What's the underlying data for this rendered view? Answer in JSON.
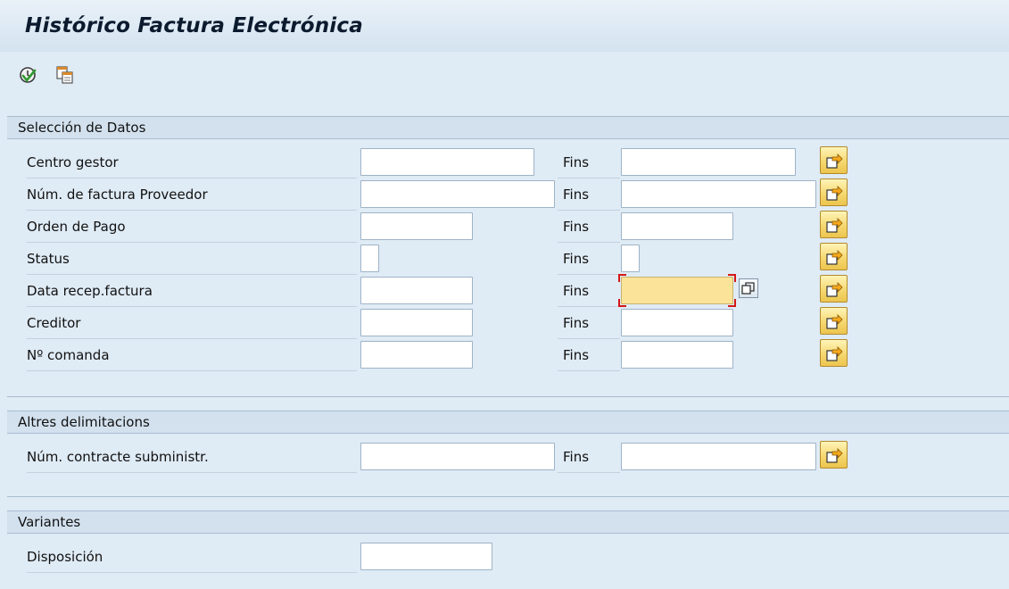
{
  "window": {
    "title": "Histórico Factura Electrónica"
  },
  "toolbar": {
    "items": [
      {
        "icon": "execute-icon"
      },
      {
        "icon": "get-variant-icon"
      }
    ]
  },
  "sections": {
    "data_selection": {
      "header": "Selección de Datos",
      "rows": [
        {
          "label": "Centro gestor",
          "to_label": "Fins",
          "from_value": "",
          "to_value": ""
        },
        {
          "label": "Núm. de factura Proveedor",
          "to_label": "Fins",
          "from_value": "",
          "to_value": ""
        },
        {
          "label": "Orden de Pago",
          "to_label": "Fins",
          "from_value": "",
          "to_value": ""
        },
        {
          "label": "Status",
          "to_label": "Fins",
          "from_value": "",
          "to_value": ""
        },
        {
          "label": "Data recep.factura",
          "to_label": "Fins",
          "from_value": "",
          "to_value": ""
        },
        {
          "label": "Creditor",
          "to_label": "Fins",
          "from_value": "",
          "to_value": ""
        },
        {
          "label": "Nº comanda",
          "to_label": "Fins",
          "from_value": "",
          "to_value": ""
        }
      ]
    },
    "other_limits": {
      "header": "Altres delimitacions",
      "rows": [
        {
          "label": "Núm. contracte subministr.",
          "to_label": "Fins",
          "from_value": "",
          "to_value": ""
        }
      ]
    },
    "variants": {
      "header": "Variantes",
      "layout_label": "Disposición",
      "layout_value": ""
    }
  },
  "colors": {
    "background": "#dfebf5",
    "focused_field": "#fbe49a",
    "focus_marker": "#d41717",
    "multiple_selection_button": "#f5d66b"
  }
}
